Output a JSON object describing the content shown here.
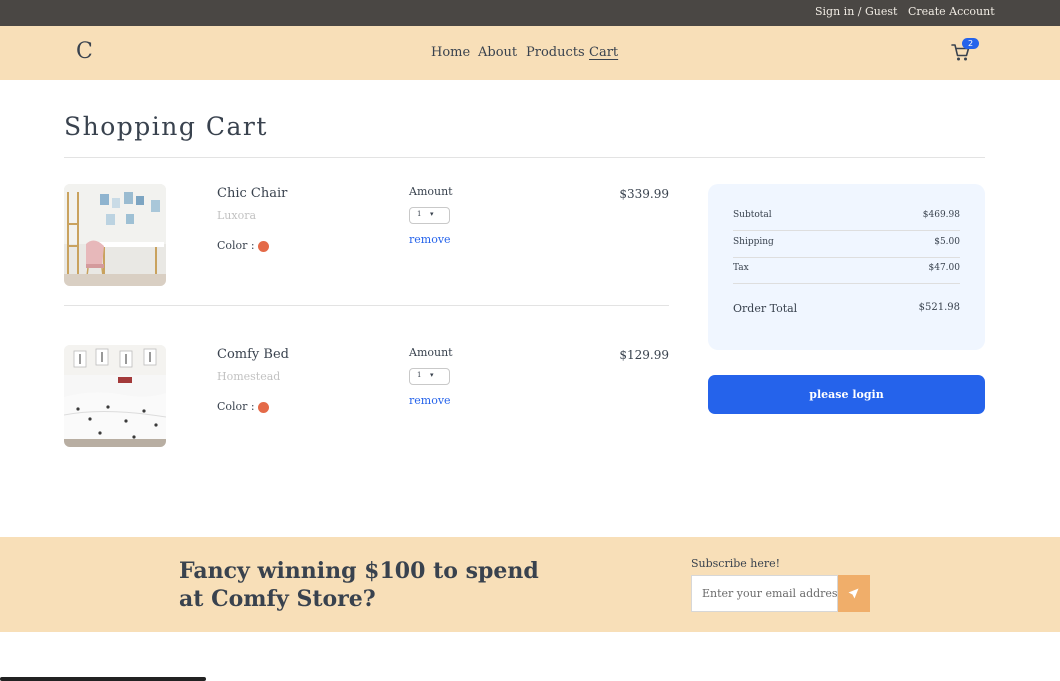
{
  "topbar": {
    "signin_label": "Sign in / Guest",
    "create_label": "Create Account"
  },
  "navbar": {
    "logo": "C",
    "links": [
      "Home",
      "About",
      "Products",
      "Cart"
    ],
    "cart_count": "2",
    "cart_icon": "cart-icon"
  },
  "page": {
    "title": "Shopping Cart"
  },
  "cart": {
    "items": [
      {
        "name": "Chic Chair",
        "company": "Luxora",
        "color_label": "Color :",
        "color": "#e46a48",
        "amount_label": "Amount",
        "quantity": "1",
        "remove_label": "remove",
        "price": "$339.99"
      },
      {
        "name": "Comfy Bed",
        "company": "Homestead",
        "color_label": "Color :",
        "color": "#e46a48",
        "amount_label": "Amount",
        "quantity": "1",
        "remove_label": "remove",
        "price": "$129.99"
      }
    ]
  },
  "summary": {
    "subtotal_label": "Subtotal",
    "subtotal": "$469.98",
    "shipping_label": "Shipping",
    "shipping": "$5.00",
    "tax_label": "Tax",
    "tax": "$47.00",
    "total_label": "Order Total",
    "total": "$521.98",
    "button_label": "please login"
  },
  "newsletter": {
    "heading": "Fancy winning $100 to spend at Comfy Store?",
    "label": "Subscribe here!",
    "placeholder": "Enter your email address"
  },
  "colors": {
    "accent": "#2563eb",
    "nav_bg": "#f8dfb8",
    "topbar_bg": "#4a4744",
    "submit_bg": "#f0ae6a"
  }
}
